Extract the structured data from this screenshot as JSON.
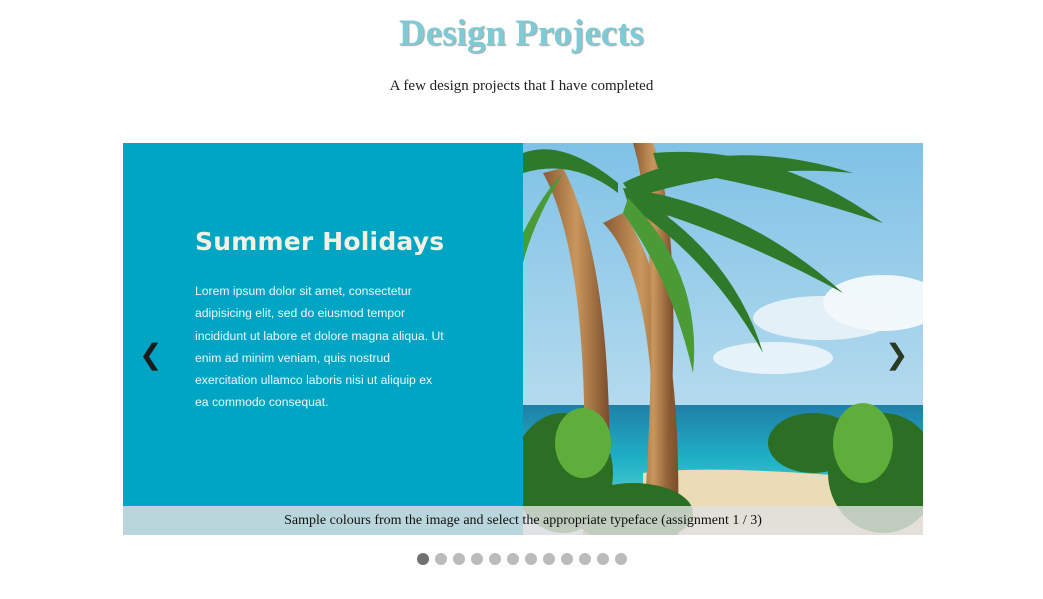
{
  "header": {
    "title": "Design Projects",
    "subtitle": "A few design projects that I have completed"
  },
  "slideshow": {
    "prev_label": "❮",
    "next_label": "❯",
    "slide": {
      "heading": "Summer Holidays",
      "body": "Lorem ipsum dolor sit amet, consectetur adipisicing elit, sed do eiusmod tempor incididunt ut labore et dolore magna aliqua. Ut enim ad minim veniam, quis nostrud exercitation ullamco laboris nisi ut aliquip ex ea commodo consequat.",
      "caption": "Sample colours from the image and select the appropriate typeface (assignment 1 / 3)",
      "panel_color": "#00a5c4"
    },
    "current_slide": 1,
    "total_slides": 12
  },
  "colors": {
    "title": "#7ecbd6",
    "dot_active": "#717171",
    "dot_inactive": "#bbbbbb"
  }
}
